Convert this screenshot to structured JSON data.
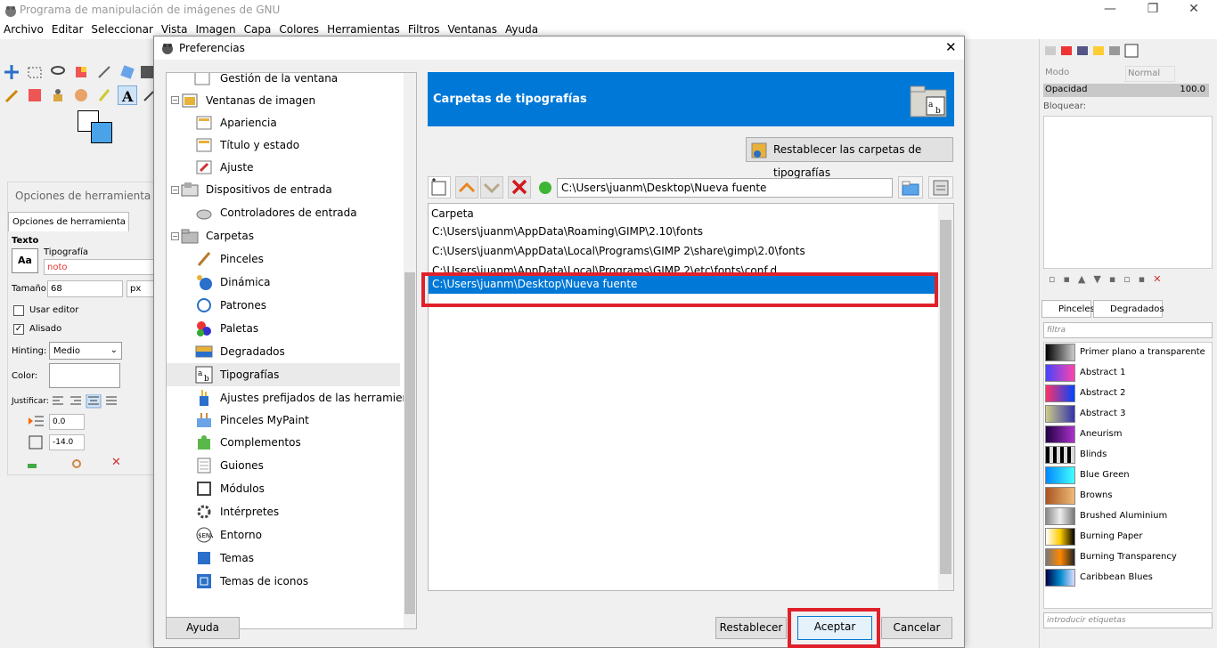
{
  "app": {
    "title": "Programa de manipulación de imágenes de GNU"
  },
  "menu": [
    "Archivo",
    "Editar",
    "Seleccionar",
    "Vista",
    "Imagen",
    "Capa",
    "Colores",
    "Herramientas",
    "Filtros",
    "Ventanas",
    "Ayuda"
  ],
  "tool_options": {
    "title": "Opciones de herramienta",
    "tab": "Opciones de herramienta",
    "section": "Texto",
    "font_label": "Tipografía",
    "font_value": "noto",
    "size_label": "Tamaño:",
    "size_value": "68",
    "unit": "px",
    "use_editor": "Usar editor",
    "antialias": "Alisado",
    "hinting_label": "Hinting:",
    "hinting_value": "Medio",
    "color_label": "Color:",
    "justify_label": "Justificar:",
    "indent_value": "0.0",
    "spacing_value": "-14.0"
  },
  "layers": {
    "mode_label": "Modo",
    "mode_value": "Normal",
    "opacity_label": "Opacidad",
    "opacity_value": "100.0",
    "lock_label": "Bloquear:"
  },
  "gradients": {
    "tab1": "Pinceles",
    "tab2": "Degradados",
    "filter_placeholder": "filtra",
    "tags_placeholder": "introducir etiquetas",
    "items": [
      "Primer plano a transparente",
      "Abstract 1",
      "Abstract 2",
      "Abstract 3",
      "Aneurism",
      "Blinds",
      "Blue Green",
      "Browns",
      "Brushed Aluminium",
      "Burning Paper",
      "Burning Transparency",
      "Caribbean Blues"
    ]
  },
  "dialog": {
    "title": "Preferencias",
    "tree": [
      "Gestión de la ventana",
      "Ventanas de imagen",
      "Apariencia",
      "Título y estado",
      "Ajuste",
      "Dispositivos de entrada",
      "Controladores de entrada",
      "Carpetas",
      "Pinceles",
      "Dinámica",
      "Patrones",
      "Paletas",
      "Degradados",
      "Tipografías",
      "Ajustes prefijados de las herramientas",
      "Pinceles MyPaint",
      "Complementos",
      "Guiones",
      "Módulos",
      "Intérpretes",
      "Entorno",
      "Temas",
      "Temas de iconos"
    ],
    "header": "Carpetas de tipografías",
    "reset_folders_button": "Restablecer las carpetas de tipografías",
    "path_value": "C:\\Users\\juanm\\Desktop\\Nueva fuente",
    "list_header": "Carpeta",
    "folders": [
      "C:\\Users\\juanm\\AppData\\Roaming\\GIMP\\2.10\\fonts",
      "C:\\Users\\juanm\\AppData\\Local\\Programs\\GIMP 2\\share\\gimp\\2.0\\fonts",
      "C:\\Users\\juanm\\AppData\\Local\\Programs\\GIMP 2\\etc\\fonts\\conf.d",
      "C:\\Users\\juanm\\Desktop\\Nueva fuente"
    ],
    "help_button": "Ayuda",
    "reset_button": "Restablecer",
    "ok_button": "Aceptar",
    "cancel_button": "Cancelar"
  },
  "colors": {
    "accent": "#0078d7",
    "highlight": "#e0202a"
  }
}
